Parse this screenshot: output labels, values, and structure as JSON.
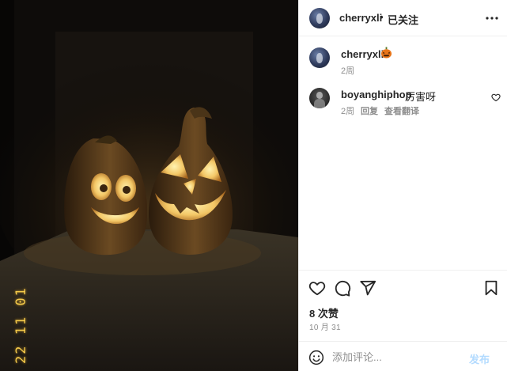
{
  "post": {
    "image_alt_label": "jack-o-lantern photo",
    "date_stamp": "22 11 01"
  },
  "header": {
    "username": "cherryxli",
    "separator": "•",
    "follow_status": "已关注",
    "more_icon": "more-horizontal-icon"
  },
  "caption": {
    "username": "cherryxli",
    "emoji": "jack-o-lantern-emoji",
    "time": "2周"
  },
  "comments": [
    {
      "username": "boyanghiphop",
      "text": "厉害呀",
      "time": "2周",
      "reply_label": "回复",
      "translate_label": "查看翻译",
      "like_icon": "heart-outline-icon"
    }
  ],
  "actions": {
    "like_icon": "heart-icon",
    "comment_icon": "comment-bubble-icon",
    "share_icon": "paper-plane-icon",
    "save_icon": "bookmark-icon",
    "likes_text": "8 次赞",
    "date": "10 月 31"
  },
  "composer": {
    "emoji_icon": "smiley-icon",
    "placeholder": "添加评论...",
    "post_label": "发布"
  },
  "colors": {
    "text": "#262626",
    "muted": "#8e8e8e",
    "divider": "#efefef",
    "post_button_disabled": "#b3dbff",
    "stamp": "#f2c84a"
  }
}
